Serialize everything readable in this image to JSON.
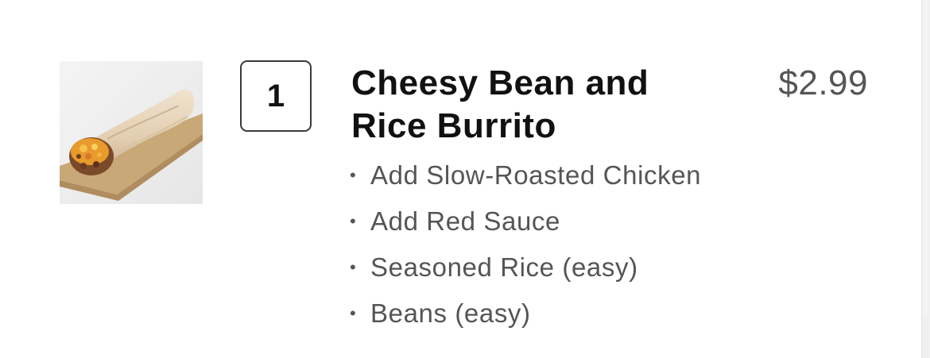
{
  "order_item": {
    "image_alt": "Cheesy Bean and Rice Burrito",
    "quantity": "1",
    "name": "Cheesy Bean and Rice Burrito",
    "price": "$2.99",
    "modifications": [
      "Add Slow-Roasted Chicken",
      "Add Red Sauce",
      "Seasoned Rice (easy)",
      "Beans (easy)"
    ]
  },
  "colors": {
    "title_text": "#111111",
    "secondary_text": "#555555",
    "quantity_border": "#3a3a3a",
    "background": "#ffffff"
  },
  "icons": {
    "bullet": "bullet-dot"
  }
}
